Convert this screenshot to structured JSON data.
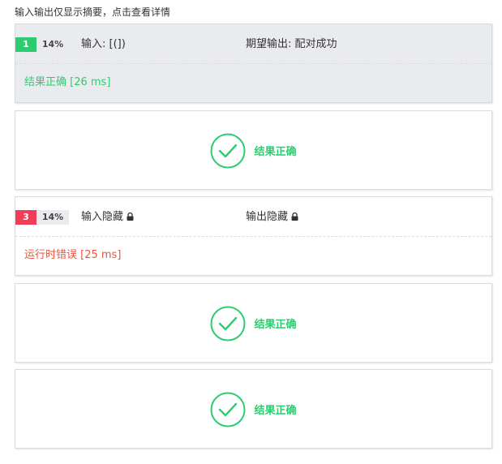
{
  "note": "输入输出仅显示摘要，点击查看详情",
  "colors": {
    "success": "#2ecc71",
    "error": "#e74c3c",
    "badge_green": "#2ecc71",
    "badge_red": "#ef3d5a",
    "highlight_bg": "#e9ebef"
  },
  "tests": [
    {
      "num": "1",
      "percent": "14%",
      "input": "输入: [(])",
      "output": "期望输出: 配对成功",
      "result": "结果正确 [26 ms]"
    },
    {
      "label": "结果正确"
    },
    {
      "num": "3",
      "percent": "14%",
      "input": "输入隐藏",
      "output": "输出隐藏",
      "result": "运行时错误 [25 ms]"
    },
    {
      "label": "结果正确"
    },
    {
      "label": "结果正确"
    }
  ]
}
